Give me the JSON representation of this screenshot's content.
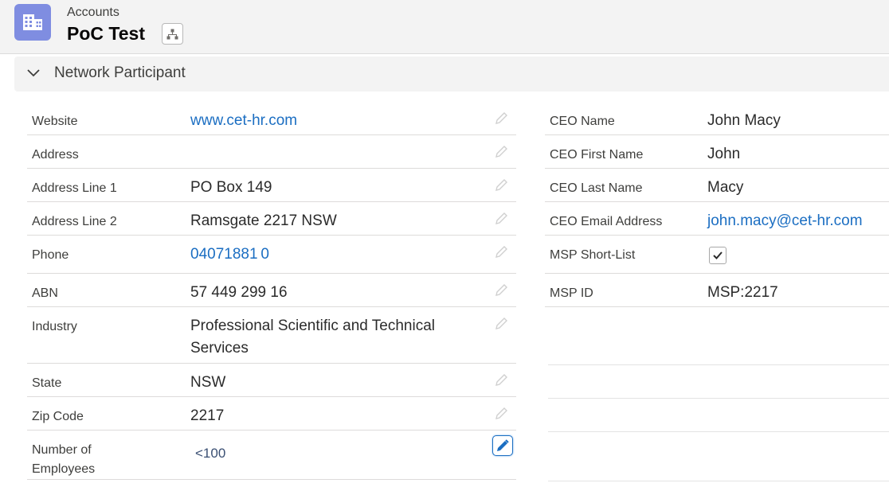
{
  "header": {
    "breadcrumb": "Accounts",
    "title": "PoC Test",
    "icon": "account-building-icon",
    "icon_color": "#7f8de1"
  },
  "section": {
    "title": "Network Participant",
    "expanded": true
  },
  "left_fields": [
    {
      "label": "Website",
      "value": "www.cet-hr.com",
      "link": true
    },
    {
      "label": "Address",
      "value": ""
    },
    {
      "label": "Address Line 1",
      "value": "PO Box 149"
    },
    {
      "label": "Address Line 2",
      "value": "Ramsgate 2217 NSW"
    },
    {
      "label": "Phone",
      "value": "04071881 0",
      "link": true
    },
    {
      "label": "ABN",
      "value": "57 449 299 16"
    },
    {
      "label": "Industry",
      "value": "Professional Scientific and Technical Services"
    },
    {
      "label": "State",
      "value": "NSW"
    },
    {
      "label": "Zip Code",
      "value": "2217"
    },
    {
      "label": "Number of Employees",
      "value": "<100",
      "editing": true
    }
  ],
  "right_fields": [
    {
      "label": "CEO Name",
      "value": "John Macy"
    },
    {
      "label": "CEO First Name",
      "value": "John"
    },
    {
      "label": "CEO Last Name",
      "value": "Macy"
    },
    {
      "label": "CEO Email Address",
      "value": "john.macy@cet-hr.com",
      "link": true
    },
    {
      "label": "MSP Short-List",
      "value": "",
      "checked": true
    },
    {
      "label": "MSP ID",
      "value": "MSP:2217"
    }
  ],
  "colors": {
    "link": "#1b6ec2",
    "label": "#3e3e3c",
    "divider": "#dddbda"
  }
}
